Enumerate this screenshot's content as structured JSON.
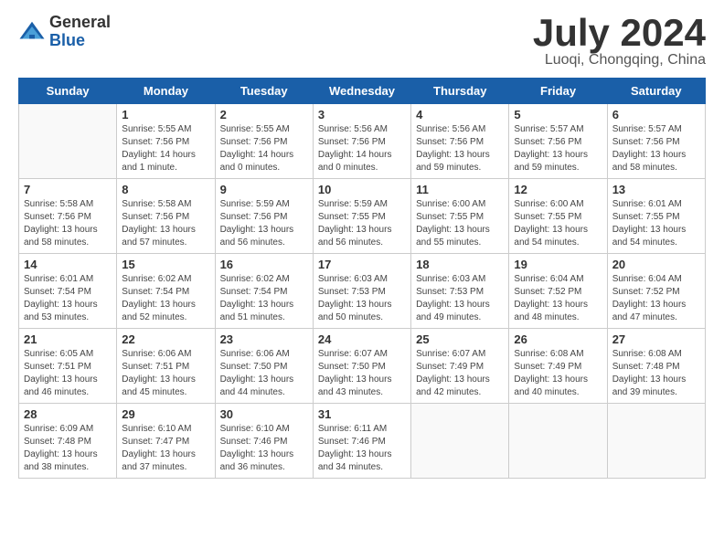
{
  "logo": {
    "general": "General",
    "blue": "Blue"
  },
  "title": "July 2024",
  "location": "Luoqi, Chongqing, China",
  "days_of_week": [
    "Sunday",
    "Monday",
    "Tuesday",
    "Wednesday",
    "Thursday",
    "Friday",
    "Saturday"
  ],
  "weeks": [
    [
      {
        "day": "",
        "sunrise": "",
        "sunset": "",
        "daylight": ""
      },
      {
        "day": "1",
        "sunrise": "Sunrise: 5:55 AM",
        "sunset": "Sunset: 7:56 PM",
        "daylight": "Daylight: 14 hours and 1 minute."
      },
      {
        "day": "2",
        "sunrise": "Sunrise: 5:55 AM",
        "sunset": "Sunset: 7:56 PM",
        "daylight": "Daylight: 14 hours and 0 minutes."
      },
      {
        "day": "3",
        "sunrise": "Sunrise: 5:56 AM",
        "sunset": "Sunset: 7:56 PM",
        "daylight": "Daylight: 14 hours and 0 minutes."
      },
      {
        "day": "4",
        "sunrise": "Sunrise: 5:56 AM",
        "sunset": "Sunset: 7:56 PM",
        "daylight": "Daylight: 13 hours and 59 minutes."
      },
      {
        "day": "5",
        "sunrise": "Sunrise: 5:57 AM",
        "sunset": "Sunset: 7:56 PM",
        "daylight": "Daylight: 13 hours and 59 minutes."
      },
      {
        "day": "6",
        "sunrise": "Sunrise: 5:57 AM",
        "sunset": "Sunset: 7:56 PM",
        "daylight": "Daylight: 13 hours and 58 minutes."
      }
    ],
    [
      {
        "day": "7",
        "sunrise": "Sunrise: 5:58 AM",
        "sunset": "Sunset: 7:56 PM",
        "daylight": "Daylight: 13 hours and 58 minutes."
      },
      {
        "day": "8",
        "sunrise": "Sunrise: 5:58 AM",
        "sunset": "Sunset: 7:56 PM",
        "daylight": "Daylight: 13 hours and 57 minutes."
      },
      {
        "day": "9",
        "sunrise": "Sunrise: 5:59 AM",
        "sunset": "Sunset: 7:56 PM",
        "daylight": "Daylight: 13 hours and 56 minutes."
      },
      {
        "day": "10",
        "sunrise": "Sunrise: 5:59 AM",
        "sunset": "Sunset: 7:55 PM",
        "daylight": "Daylight: 13 hours and 56 minutes."
      },
      {
        "day": "11",
        "sunrise": "Sunrise: 6:00 AM",
        "sunset": "Sunset: 7:55 PM",
        "daylight": "Daylight: 13 hours and 55 minutes."
      },
      {
        "day": "12",
        "sunrise": "Sunrise: 6:00 AM",
        "sunset": "Sunset: 7:55 PM",
        "daylight": "Daylight: 13 hours and 54 minutes."
      },
      {
        "day": "13",
        "sunrise": "Sunrise: 6:01 AM",
        "sunset": "Sunset: 7:55 PM",
        "daylight": "Daylight: 13 hours and 54 minutes."
      }
    ],
    [
      {
        "day": "14",
        "sunrise": "Sunrise: 6:01 AM",
        "sunset": "Sunset: 7:54 PM",
        "daylight": "Daylight: 13 hours and 53 minutes."
      },
      {
        "day": "15",
        "sunrise": "Sunrise: 6:02 AM",
        "sunset": "Sunset: 7:54 PM",
        "daylight": "Daylight: 13 hours and 52 minutes."
      },
      {
        "day": "16",
        "sunrise": "Sunrise: 6:02 AM",
        "sunset": "Sunset: 7:54 PM",
        "daylight": "Daylight: 13 hours and 51 minutes."
      },
      {
        "day": "17",
        "sunrise": "Sunrise: 6:03 AM",
        "sunset": "Sunset: 7:53 PM",
        "daylight": "Daylight: 13 hours and 50 minutes."
      },
      {
        "day": "18",
        "sunrise": "Sunrise: 6:03 AM",
        "sunset": "Sunset: 7:53 PM",
        "daylight": "Daylight: 13 hours and 49 minutes."
      },
      {
        "day": "19",
        "sunrise": "Sunrise: 6:04 AM",
        "sunset": "Sunset: 7:52 PM",
        "daylight": "Daylight: 13 hours and 48 minutes."
      },
      {
        "day": "20",
        "sunrise": "Sunrise: 6:04 AM",
        "sunset": "Sunset: 7:52 PM",
        "daylight": "Daylight: 13 hours and 47 minutes."
      }
    ],
    [
      {
        "day": "21",
        "sunrise": "Sunrise: 6:05 AM",
        "sunset": "Sunset: 7:51 PM",
        "daylight": "Daylight: 13 hours and 46 minutes."
      },
      {
        "day": "22",
        "sunrise": "Sunrise: 6:06 AM",
        "sunset": "Sunset: 7:51 PM",
        "daylight": "Daylight: 13 hours and 45 minutes."
      },
      {
        "day": "23",
        "sunrise": "Sunrise: 6:06 AM",
        "sunset": "Sunset: 7:50 PM",
        "daylight": "Daylight: 13 hours and 44 minutes."
      },
      {
        "day": "24",
        "sunrise": "Sunrise: 6:07 AM",
        "sunset": "Sunset: 7:50 PM",
        "daylight": "Daylight: 13 hours and 43 minutes."
      },
      {
        "day": "25",
        "sunrise": "Sunrise: 6:07 AM",
        "sunset": "Sunset: 7:49 PM",
        "daylight": "Daylight: 13 hours and 42 minutes."
      },
      {
        "day": "26",
        "sunrise": "Sunrise: 6:08 AM",
        "sunset": "Sunset: 7:49 PM",
        "daylight": "Daylight: 13 hours and 40 minutes."
      },
      {
        "day": "27",
        "sunrise": "Sunrise: 6:08 AM",
        "sunset": "Sunset: 7:48 PM",
        "daylight": "Daylight: 13 hours and 39 minutes."
      }
    ],
    [
      {
        "day": "28",
        "sunrise": "Sunrise: 6:09 AM",
        "sunset": "Sunset: 7:48 PM",
        "daylight": "Daylight: 13 hours and 38 minutes."
      },
      {
        "day": "29",
        "sunrise": "Sunrise: 6:10 AM",
        "sunset": "Sunset: 7:47 PM",
        "daylight": "Daylight: 13 hours and 37 minutes."
      },
      {
        "day": "30",
        "sunrise": "Sunrise: 6:10 AM",
        "sunset": "Sunset: 7:46 PM",
        "daylight": "Daylight: 13 hours and 36 minutes."
      },
      {
        "day": "31",
        "sunrise": "Sunrise: 6:11 AM",
        "sunset": "Sunset: 7:46 PM",
        "daylight": "Daylight: 13 hours and 34 minutes."
      },
      {
        "day": "",
        "sunrise": "",
        "sunset": "",
        "daylight": ""
      },
      {
        "day": "",
        "sunrise": "",
        "sunset": "",
        "daylight": ""
      },
      {
        "day": "",
        "sunrise": "",
        "sunset": "",
        "daylight": ""
      }
    ]
  ]
}
